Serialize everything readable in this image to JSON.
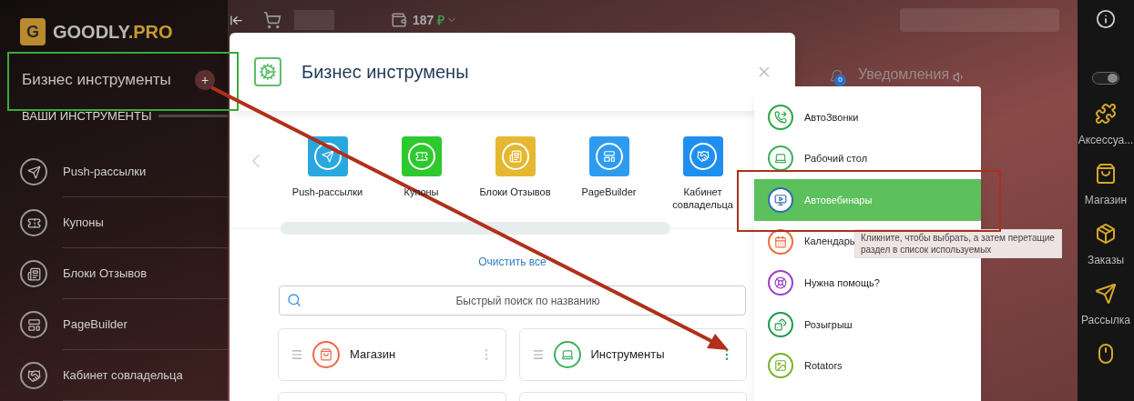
{
  "brand": {
    "logo_letter": "G",
    "name": "GOODLY",
    "suffix": ".PRO"
  },
  "sidebar": {
    "section_title": "Бизнес инструменты",
    "add_label": "+",
    "heading": "ВАШИ ИНСТРУМЕНТЫ",
    "items": [
      {
        "label": "Push-рассылки"
      },
      {
        "label": "Купоны"
      },
      {
        "label": "Блоки Отзывов"
      },
      {
        "label": "PageBuilder"
      },
      {
        "label": "Кабинет совладельца"
      }
    ]
  },
  "top_bar": {
    "balance": "187",
    "currency": "₽"
  },
  "notifications": {
    "count": "0",
    "label": "Уведомления"
  },
  "modal": {
    "title": "Бизнес инструмены",
    "tiles": [
      {
        "label": "Push-рассылки",
        "color": "#29a8e0"
      },
      {
        "label": "Купоны",
        "color": "#2ec92e"
      },
      {
        "label": "Блоки Отзывов",
        "color": "#e5b830"
      },
      {
        "label": "PageBuilder",
        "color": "#2d9cf0"
      },
      {
        "label": "Кабинет совладельца",
        "color": "#1e8ff0"
      }
    ],
    "clear_link": "Очистить все",
    "search": {
      "placeholder": "Быстрый поиск по названию"
    },
    "cards": [
      {
        "label": "Магазин",
        "color": "#f06548",
        "active": false
      },
      {
        "label": "Инструменты",
        "color": "#3bb15b",
        "active": true
      }
    ]
  },
  "menu": {
    "items": [
      {
        "label": "АвтоЗвонки",
        "color": "#27a844",
        "selected": false
      },
      {
        "label": "Рабочий стол",
        "color": "#3bb15b",
        "selected": false
      },
      {
        "label": "Автовебинары",
        "color": "#2f6fb0",
        "selected": true
      },
      {
        "label": "Календарь",
        "color": "#f06a3c",
        "selected": false
      },
      {
        "label": "Нужна помощь?",
        "color": "#9b3fd0",
        "selected": false
      },
      {
        "label": "Розыгрыш",
        "color": "#1f9a4a",
        "selected": false
      },
      {
        "label": "Rotators",
        "color": "#7ab02a",
        "selected": false
      }
    ],
    "tooltip": "Кликните, чтобы выбрать, а затем перетащие раздел в список используемых"
  },
  "right_bar": {
    "toggle": {
      "on": true
    },
    "items": [
      {
        "label": "Аксессуа..."
      },
      {
        "label": "Магазин"
      },
      {
        "label": "Заказы"
      },
      {
        "label": "Рассылка"
      }
    ]
  }
}
